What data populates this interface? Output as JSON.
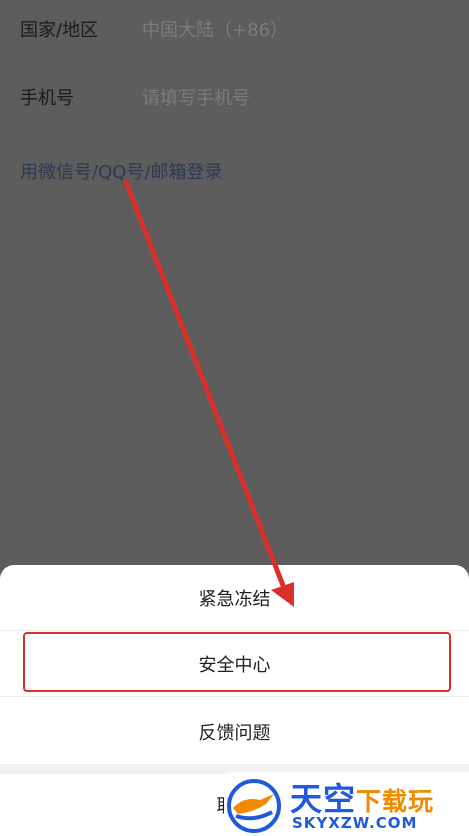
{
  "login_form": {
    "country_label": "国家/地区",
    "country_value": "中国大陆（+86）",
    "phone_label": "手机号",
    "phone_placeholder": "请填写手机号",
    "alt_login_link": "用微信号/QQ号/邮箱登录"
  },
  "action_sheet": {
    "items": [
      {
        "label": "紧急冻结"
      },
      {
        "label": "安全中心"
      },
      {
        "label": "反馈问题"
      }
    ],
    "cancel_label": "取消"
  },
  "annotation": {
    "color": "#d9302b"
  },
  "watermark": {
    "title": "天空",
    "subtitle": "下载玩",
    "url": "SKYXZW.COM"
  }
}
